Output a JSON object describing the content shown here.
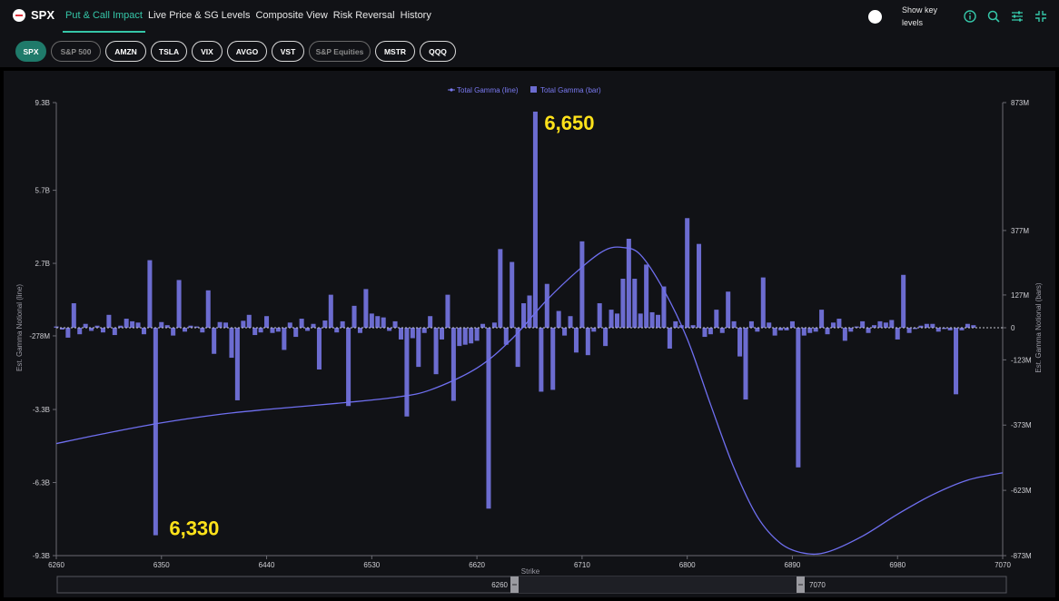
{
  "header": {
    "brand": "SPX",
    "tabs": [
      "Put & Call Impact",
      "Live Price & SG Levels",
      "Composite View",
      "Risk Reversal",
      "History"
    ],
    "active_tab": 0,
    "show_key_label": "Show key levels"
  },
  "tickers": [
    {
      "label": "SPX",
      "state": "selected"
    },
    {
      "label": "S&P 500",
      "state": "dim"
    },
    {
      "label": "AMZN",
      "state": "normal"
    },
    {
      "label": "TSLA",
      "state": "normal"
    },
    {
      "label": "VIX",
      "state": "normal"
    },
    {
      "label": "AVGO",
      "state": "normal"
    },
    {
      "label": "VST",
      "state": "normal"
    },
    {
      "label": "S&P Equities",
      "state": "dim"
    },
    {
      "label": "MSTR",
      "state": "normal"
    },
    {
      "label": "QQQ",
      "state": "normal"
    }
  ],
  "colors": {
    "accent": "#35c6a8",
    "bar": "#6c6cd0",
    "line": "#6f6ff0",
    "annotation": "#ffe21a"
  },
  "chart_data": {
    "type": "bar+line",
    "legend": [
      "Total Gamma (line)",
      "Total Gamma (bar)"
    ],
    "legend_position": "top-center",
    "xlabel": "Strike",
    "ylabel_left": "Est. Gamma Notional (line)",
    "ylabel_right": "Est. Gamma Notional (bars)",
    "xlim": [
      6260,
      7070
    ],
    "x_ticks": [
      6260,
      6350,
      6440,
      6530,
      6620,
      6710,
      6800,
      6890,
      6980,
      7070
    ],
    "ylim_left": [
      -9.3,
      9.3
    ],
    "left_ticks": [
      {
        "v": 9.3,
        "label": "9.3B"
      },
      {
        "v": 5.7,
        "label": "5.7B"
      },
      {
        "v": 2.7,
        "label": "2.7B"
      },
      {
        "v": -0.278,
        "label": "-278M"
      },
      {
        "v": -3.3,
        "label": "-3.3B"
      },
      {
        "v": -6.3,
        "label": "-6.3B"
      },
      {
        "v": -9.3,
        "label": "-9.3B"
      }
    ],
    "ylim_right": [
      -873,
      873
    ],
    "right_ticks": [
      {
        "v": 873,
        "label": "873M"
      },
      {
        "v": 377,
        "label": "377M"
      },
      {
        "v": 127,
        "label": "127M"
      },
      {
        "v": 0,
        "label": "0"
      },
      {
        "v": -123,
        "label": "-123M"
      },
      {
        "v": -373,
        "label": "-373M"
      },
      {
        "v": -623,
        "label": "-623M"
      },
      {
        "v": -873,
        "label": "-873M"
      }
    ],
    "bars_unit": "M",
    "bars": [
      [
        6260,
        5
      ],
      [
        6265,
        -7
      ],
      [
        6270,
        -38
      ],
      [
        6275,
        95
      ],
      [
        6280,
        -25
      ],
      [
        6285,
        15
      ],
      [
        6290,
        -12
      ],
      [
        6295,
        8
      ],
      [
        6300,
        -18
      ],
      [
        6305,
        50
      ],
      [
        6310,
        -28
      ],
      [
        6315,
        8
      ],
      [
        6320,
        35
      ],
      [
        6325,
        25
      ],
      [
        6330,
        20
      ],
      [
        6335,
        -25
      ],
      [
        6340,
        262
      ],
      [
        6345,
        -795
      ],
      [
        6350,
        22
      ],
      [
        6355,
        10
      ],
      [
        6360,
        -30
      ],
      [
        6365,
        185
      ],
      [
        6370,
        -15
      ],
      [
        6375,
        8
      ],
      [
        6380,
        5
      ],
      [
        6385,
        -18
      ],
      [
        6390,
        145
      ],
      [
        6395,
        -100
      ],
      [
        6400,
        22
      ],
      [
        6405,
        20
      ],
      [
        6410,
        -115
      ],
      [
        6415,
        -278
      ],
      [
        6420,
        27
      ],
      [
        6425,
        50
      ],
      [
        6430,
        -28
      ],
      [
        6435,
        -18
      ],
      [
        6440,
        45
      ],
      [
        6445,
        -20
      ],
      [
        6450,
        -15
      ],
      [
        6455,
        -85
      ],
      [
        6460,
        20
      ],
      [
        6465,
        -35
      ],
      [
        6470,
        35
      ],
      [
        6475,
        -12
      ],
      [
        6480,
        15
      ],
      [
        6485,
        -160
      ],
      [
        6490,
        28
      ],
      [
        6495,
        128
      ],
      [
        6500,
        -18
      ],
      [
        6505,
        25
      ],
      [
        6510,
        -300
      ],
      [
        6515,
        85
      ],
      [
        6520,
        -20
      ],
      [
        6525,
        150
      ],
      [
        6530,
        55
      ],
      [
        6535,
        45
      ],
      [
        6540,
        40
      ],
      [
        6545,
        -12
      ],
      [
        6550,
        25
      ],
      [
        6555,
        -45
      ],
      [
        6560,
        -340
      ],
      [
        6565,
        -40
      ],
      [
        6570,
        -150
      ],
      [
        6575,
        -20
      ],
      [
        6580,
        45
      ],
      [
        6585,
        -178
      ],
      [
        6590,
        -45
      ],
      [
        6595,
        128
      ],
      [
        6600,
        -280
      ],
      [
        6605,
        -70
      ],
      [
        6610,
        -65
      ],
      [
        6615,
        -60
      ],
      [
        6620,
        -50
      ],
      [
        6625,
        15
      ],
      [
        6630,
        -693
      ],
      [
        6635,
        20
      ],
      [
        6640,
        305
      ],
      [
        6645,
        -65
      ],
      [
        6650,
        255
      ],
      [
        6655,
        -150
      ],
      [
        6660,
        95
      ],
      [
        6665,
        125
      ],
      [
        6670,
        838
      ],
      [
        6675,
        -245
      ],
      [
        6680,
        170
      ],
      [
        6685,
        -238
      ],
      [
        6690,
        65
      ],
      [
        6695,
        -30
      ],
      [
        6700,
        45
      ],
      [
        6705,
        -95
      ],
      [
        6710,
        335
      ],
      [
        6715,
        -105
      ],
      [
        6720,
        -15
      ],
      [
        6725,
        95
      ],
      [
        6730,
        -70
      ],
      [
        6735,
        70
      ],
      [
        6740,
        55
      ],
      [
        6745,
        190
      ],
      [
        6750,
        345
      ],
      [
        6755,
        190
      ],
      [
        6760,
        55
      ],
      [
        6765,
        245
      ],
      [
        6770,
        60
      ],
      [
        6775,
        50
      ],
      [
        6780,
        160
      ],
      [
        6785,
        -80
      ],
      [
        6790,
        25
      ],
      [
        6795,
        10
      ],
      [
        6800,
        425
      ],
      [
        6805,
        10
      ],
      [
        6810,
        325
      ],
      [
        6815,
        -35
      ],
      [
        6820,
        -25
      ],
      [
        6825,
        70
      ],
      [
        6830,
        -20
      ],
      [
        6835,
        140
      ],
      [
        6840,
        25
      ],
      [
        6845,
        -110
      ],
      [
        6850,
        -275
      ],
      [
        6855,
        25
      ],
      [
        6860,
        -15
      ],
      [
        6865,
        195
      ],
      [
        6870,
        20
      ],
      [
        6875,
        -30
      ],
      [
        6880,
        -10
      ],
      [
        6885,
        -10
      ],
      [
        6890,
        25
      ],
      [
        6895,
        -535
      ],
      [
        6900,
        -30
      ],
      [
        6905,
        -20
      ],
      [
        6910,
        -15
      ],
      [
        6915,
        70
      ],
      [
        6920,
        -25
      ],
      [
        6925,
        20
      ],
      [
        6930,
        35
      ],
      [
        6935,
        -50
      ],
      [
        6940,
        -15
      ],
      [
        6945,
        5
      ],
      [
        6950,
        25
      ],
      [
        6955,
        -20
      ],
      [
        6960,
        10
      ],
      [
        6965,
        25
      ],
      [
        6970,
        20
      ],
      [
        6975,
        30
      ],
      [
        6980,
        -45
      ],
      [
        6985,
        205
      ],
      [
        6990,
        -20
      ],
      [
        6995,
        -5
      ],
      [
        7000,
        8
      ],
      [
        7005,
        15
      ],
      [
        7010,
        15
      ],
      [
        7015,
        -15
      ],
      [
        7020,
        -5
      ],
      [
        7025,
        -10
      ],
      [
        7030,
        -255
      ],
      [
        7035,
        -10
      ],
      [
        7040,
        15
      ],
      [
        7045,
        10
      ]
    ],
    "line_unit": "B",
    "line": [
      [
        6260,
        -4.7
      ],
      [
        6300,
        -4.3
      ],
      [
        6350,
        -3.85
      ],
      [
        6400,
        -3.5
      ],
      [
        6440,
        -3.3
      ],
      [
        6500,
        -3.05
      ],
      [
        6550,
        -2.8
      ],
      [
        6580,
        -2.5
      ],
      [
        6620,
        -1.6
      ],
      [
        6650,
        -0.4
      ],
      [
        6680,
        1.2
      ],
      [
        6710,
        2.55
      ],
      [
        6730,
        3.25
      ],
      [
        6745,
        3.35
      ],
      [
        6760,
        3.05
      ],
      [
        6780,
        1.6
      ],
      [
        6800,
        -0.4
      ],
      [
        6820,
        -3.1
      ],
      [
        6840,
        -5.7
      ],
      [
        6860,
        -7.7
      ],
      [
        6880,
        -8.8
      ],
      [
        6900,
        -9.2
      ],
      [
        6920,
        -9.15
      ],
      [
        6950,
        -8.5
      ],
      [
        6980,
        -7.6
      ],
      [
        7010,
        -6.8
      ],
      [
        7040,
        -6.2
      ],
      [
        7070,
        -5.9
      ]
    ],
    "annotations": [
      {
        "text": "6,650",
        "x": 6670,
        "y": 838
      },
      {
        "text": "6,330",
        "x": 6345,
        "y": -795
      }
    ]
  },
  "range_slider": {
    "from": "6260",
    "to": "7070"
  }
}
